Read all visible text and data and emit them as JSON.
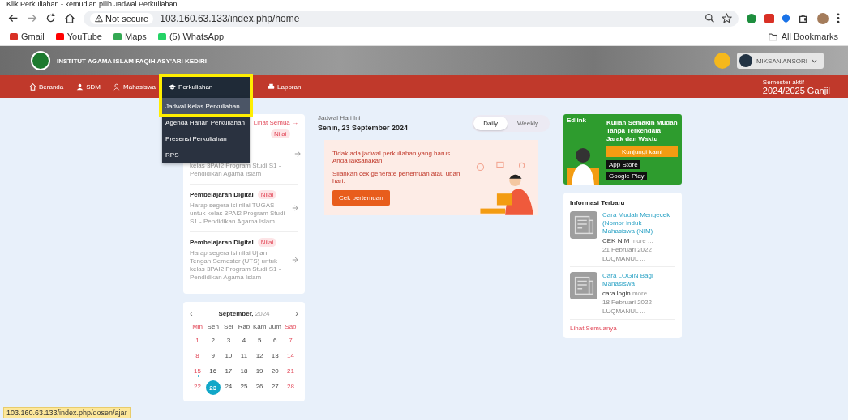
{
  "instruction": "Klik Perkuliahan - kemudian pilih Jadwal Perkuliahan",
  "browser": {
    "security": "Not secure",
    "url": "103.160.63.133/index.php/home",
    "bookmarks": [
      {
        "label": "Gmail",
        "kind": "gmail"
      },
      {
        "label": "YouTube",
        "kind": "youtube"
      },
      {
        "label": "Maps",
        "kind": "maps"
      },
      {
        "label": "(5) WhatsApp",
        "kind": "whatsapp"
      }
    ],
    "all_bookmarks": "All Bookmarks"
  },
  "site": {
    "institution": "INSTITUT AGAMA ISLAM FAQIH ASY'ARI KEDIRI",
    "user": "MIKSAN ANSORI",
    "semester_label": "Semester aktif :",
    "semester": "2024/2025 Ganjil"
  },
  "nav": [
    {
      "label": "Beranda",
      "kind": "home",
      "selected": false
    },
    {
      "label": "SDM",
      "kind": "person",
      "selected": false
    },
    {
      "label": "Mahasiswa",
      "kind": "people",
      "selected": false
    },
    {
      "label": "Perkuliahan",
      "kind": "cap",
      "selected": true
    },
    {
      "label": "Laporan",
      "kind": "print",
      "selected": false
    }
  ],
  "dropdown": [
    {
      "label": "Jadwal Kelas Perkuliahan",
      "selected": true
    },
    {
      "label": "Agenda Harian Perkuliahan",
      "selected": false
    },
    {
      "label": "Presensi Perkuliahan",
      "selected": false
    },
    {
      "label": "RPS",
      "selected": false
    }
  ],
  "notifications": {
    "link": "Lihat Semua →",
    "items": [
      {
        "badge": "Nilai",
        "text": "kelas 3PAI2 Program Studi S1 - Pendidikan Agama Islam"
      },
      {
        "title": "Pembelajaran Digital",
        "badge": "Nilai",
        "text": "Harap segera isi nilai TUGAS untuk kelas 3PAI2 Program Studi S1 - Pendidikan Agama Islam"
      },
      {
        "title": "Pembelajaran Digital",
        "badge": "Nilai",
        "text": "Harap segera isi nilai Ujian Tengah Semester (UTS) untuk kelas 3PAI2 Program Studi S1 - Pendidikan Agama Islam"
      }
    ]
  },
  "calendar": {
    "prev": "‹",
    "month": "September,",
    "year": "2024",
    "next": "›",
    "weekdays": [
      "Min",
      "Sen",
      "Sel",
      "Rab",
      "Kam",
      "Jum",
      "Sab"
    ],
    "days": [
      {
        "day": "1",
        "selected": false,
        "event": false
      },
      {
        "day": "2",
        "selected": false,
        "event": false
      },
      {
        "day": "3",
        "selected": false,
        "event": false
      },
      {
        "day": "4",
        "selected": false,
        "event": false
      },
      {
        "day": "5",
        "selected": false,
        "event": false
      },
      {
        "day": "6",
        "selected": false,
        "event": false
      },
      {
        "day": "7",
        "selected": false,
        "event": false
      },
      {
        "day": "8",
        "selected": false,
        "event": false
      },
      {
        "day": "9",
        "selected": false,
        "event": false
      },
      {
        "day": "10",
        "selected": false,
        "event": false
      },
      {
        "day": "11",
        "selected": false,
        "event": false
      },
      {
        "day": "12",
        "selected": false,
        "event": false
      },
      {
        "day": "13",
        "selected": false,
        "event": false
      },
      {
        "day": "14",
        "selected": false,
        "event": false
      },
      {
        "day": "15",
        "selected": false,
        "event": true
      },
      {
        "day": "16",
        "selected": false,
        "event": false
      },
      {
        "day": "17",
        "selected": false,
        "event": false
      },
      {
        "day": "18",
        "selected": false,
        "event": false
      },
      {
        "day": "19",
        "selected": false,
        "event": false
      },
      {
        "day": "20",
        "selected": false,
        "event": false
      },
      {
        "day": "21",
        "selected": false,
        "event": false
      },
      {
        "day": "22",
        "selected": false,
        "event": false
      },
      {
        "day": "23",
        "selected": true,
        "event": false
      },
      {
        "day": "24",
        "selected": false,
        "event": false
      },
      {
        "day": "25",
        "selected": false,
        "event": false
      },
      {
        "day": "26",
        "selected": false,
        "event": false
      },
      {
        "day": "27",
        "selected": false,
        "event": false
      },
      {
        "day": "28",
        "selected": false,
        "event": false
      }
    ]
  },
  "schedule": {
    "label": "Jadwal Hari Ini",
    "date": "Senin, 23 September 2024",
    "views": [
      {
        "label": "Daily",
        "selected": true
      },
      {
        "label": "Weekly",
        "selected": false
      }
    ],
    "message": "Tidak ada jadwal perkuliahan yang harus Anda laksanakan",
    "hint": "Silahkan cek generate pertemuan atau ubah hari.",
    "button": "Cek pertemuan"
  },
  "promo": {
    "brand": "Edlink",
    "headline": "Kuliah Semakin Mudah Tanpa Terkendala Jarak dan Waktu",
    "button": "Kunjungi kami",
    "stores": [
      "App Store",
      "Google Play"
    ]
  },
  "news": {
    "title": "Informasi Terbaru",
    "items": [
      {
        "title": "Cara Mudah Mengecek (Nomor Induk Mahasiswa (NIM)",
        "excerpt": "CEK NIM",
        "more": "more ...",
        "date": "21 Februari 2022",
        "author": "LUQMANUL ..."
      },
      {
        "title": "Cara LOGIN Bagi Mahasiswa",
        "excerpt": "cara login",
        "more": "more ...",
        "date": "18 Februari 2022",
        "author": "LUQMANUL ..."
      }
    ],
    "link": "Lihat Semuanya →"
  },
  "status_url": "103.160.63.133/index.php/dosen/ajar"
}
